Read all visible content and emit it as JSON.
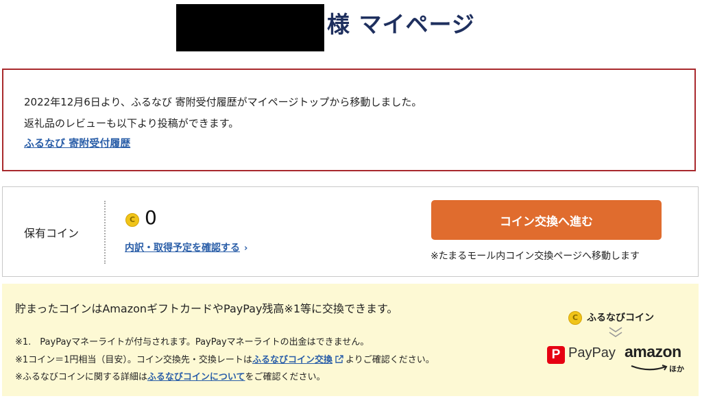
{
  "header": {
    "title": "様 マイページ"
  },
  "notice": {
    "line1": "2022年12月6日より、ふるなび 寄附受付履歴がマイページトップから移動しました。",
    "line2": "返礼品のレビューも以下より投稿ができます。",
    "link": "ふるなび 寄附受付履歴"
  },
  "coins": {
    "label": "保有コイン",
    "coin_icon_glyph": "C",
    "amount": "0",
    "detail_link": "内訳・取得予定を確認する",
    "detail_chevron": "›",
    "exchange_button": "コイン交換へ進む",
    "exchange_note": "※たまるモール内コイン交換ページへ移動します"
  },
  "info": {
    "main_text": "貯まったコインはAmazonギフトカードやPayPay残高※1等に交換できます。",
    "note1": "※1.　PayPayマネーライトが付与されます。PayPayマネーライトの出金はできません。",
    "note2_prefix": "※1コイン＝1円相当（目安）。コイン交換先・交換レートは",
    "note2_link": "ふるなびコイン交換",
    "note2_suffix": "よりご確認ください。",
    "note3_prefix": "※ふるなびコインに関する詳細は",
    "note3_link": "ふるなびコインについて",
    "note3_suffix": "をご確認ください。"
  },
  "brand": {
    "coin_name": "ふるなびコイン",
    "paypay_mark": "P",
    "paypay": "PayPay",
    "amazon": "amazon",
    "others": "ほか"
  },
  "colors": {
    "title": "#1e2f5e",
    "notice_border": "#a8282c",
    "link": "#2a5ea8",
    "button": "#e06c2e",
    "info_bg": "#fdf9d4",
    "coin": "#f0c419",
    "paypay_red": "#e60012"
  }
}
